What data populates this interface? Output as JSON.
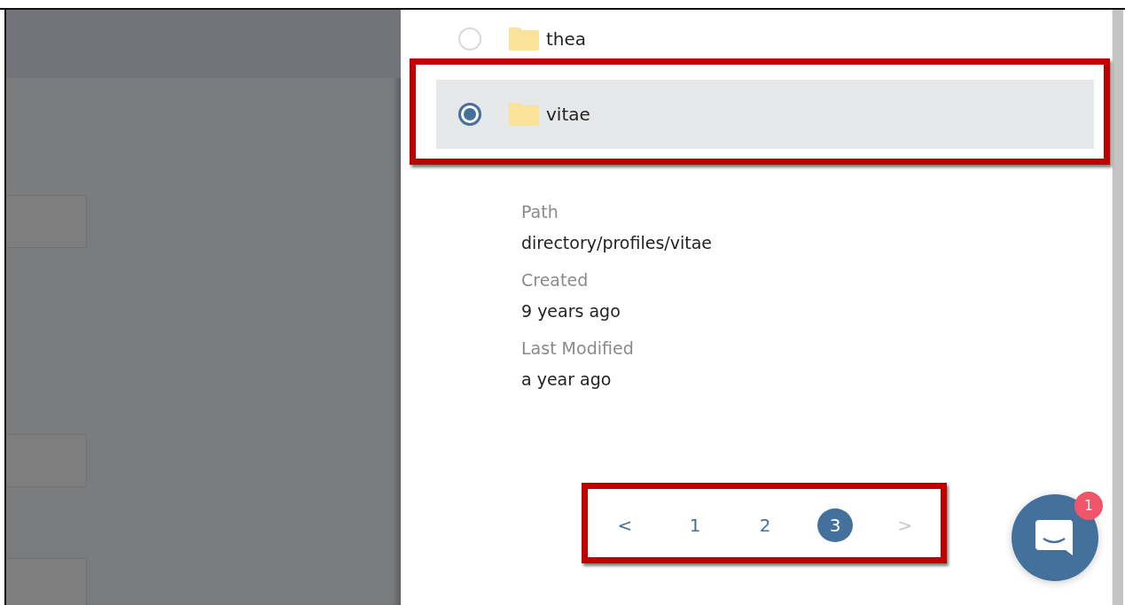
{
  "folders": [
    {
      "name": "thea",
      "selected": false
    },
    {
      "name": "vitae",
      "selected": true
    }
  ],
  "details": [
    {
      "label": "Path",
      "value": "directory/profiles/vitae"
    },
    {
      "label": "Created",
      "value": "9 years ago"
    },
    {
      "label": "Last Modified",
      "value": "a year ago"
    }
  ],
  "pagination": {
    "prev": "<",
    "next": ">",
    "next_disabled": true,
    "pages": [
      {
        "label": "1",
        "selected": false
      },
      {
        "label": "2",
        "selected": false
      },
      {
        "label": "3",
        "selected": true
      }
    ]
  },
  "chat": {
    "badge": "1"
  }
}
